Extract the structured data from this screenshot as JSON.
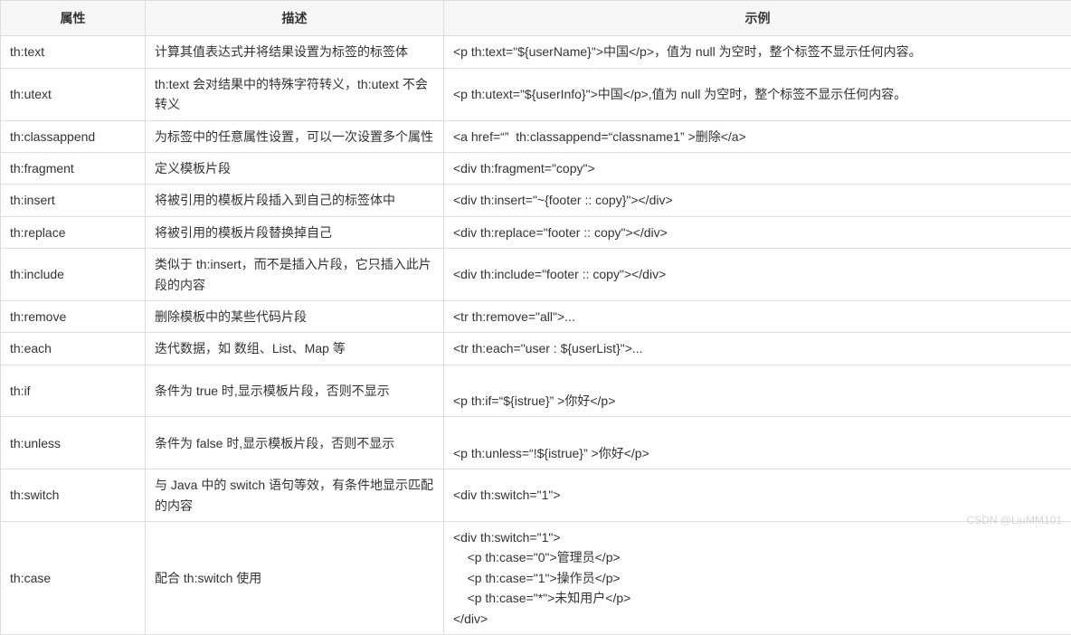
{
  "headers": {
    "attr": "属性",
    "desc": "描述",
    "example": "示例"
  },
  "rows": [
    {
      "attr": "th:text",
      "desc": "计算其值表达式并将结果设置为标签的标签体",
      "example": "<p th:text=\"${userName}\">中国</p>，值为 null 为空时，整个标签不显示任何内容。"
    },
    {
      "attr": "th:utext",
      "desc": "th:text 会对结果中的特殊字符转义，th:utext 不会转义",
      "example": "<p th:utext=\"${userInfo}\">中国</p>,值为 null 为空时，整个标签不显示任何内容。"
    },
    {
      "attr": "th:classappend",
      "desc": "为标签中的任意属性设置，可以一次设置多个属性",
      "example": "<a href=“”  th:classappend=“classname1” >删除</a>"
    },
    {
      "attr": "th:fragment",
      "desc": "定义模板片段",
      "example": "<div th:fragment=\"copy\">"
    },
    {
      "attr": "th:insert",
      "desc": "将被引用的模板片段插入到自己的标签体中",
      "example": "<div th:insert=\"~{footer :: copy}\"></div>"
    },
    {
      "attr": "th:replace",
      "desc": "将被引用的模板片段替换掉自己",
      "example": "<div th:replace=\"footer :: copy\"></div>"
    },
    {
      "attr": "th:include",
      "desc": "类似于 th:insert，而不是插入片段，它只插入此片段的内容",
      "example": "<div th:include=\"footer :: copy\"></div>"
    },
    {
      "attr": "th:remove",
      "desc": "删除模板中的某些代码片段",
      "example": "<tr th:remove=\"all\">..."
    },
    {
      "attr": "th:each",
      "desc": "迭代数据，如 数组、List、Map 等",
      "example": "<tr th:each=\"user : ${userList}\">..."
    },
    {
      "attr": "th:if",
      "desc": "条件为 true 时,显示模板片段，否则不显示",
      "example": "\n<p th:if=“${istrue}” >你好</p>\n"
    },
    {
      "attr": "th:unless",
      "desc": "条件为 false 时,显示模板片段，否则不显示",
      "example": "\n<p th:unless=“!${istrue}” >你好</p>\n"
    },
    {
      "attr": "th:switch",
      "desc": "与 Java 中的 switch 语句等效，有条件地显示匹配的内容",
      "example": "<div th:switch=\"1\">"
    },
    {
      "attr": "th:case",
      "desc": "配合 th:switch 使用",
      "example": "<div th:switch=\"1\">\n    <p th:case=\"0\">管理员</p>\n    <p th:case=\"1\">操作员</p>\n    <p th:case=\"*\">未知用户</p>\n</div>"
    }
  ],
  "watermark": "CSDN @LiuMM101"
}
